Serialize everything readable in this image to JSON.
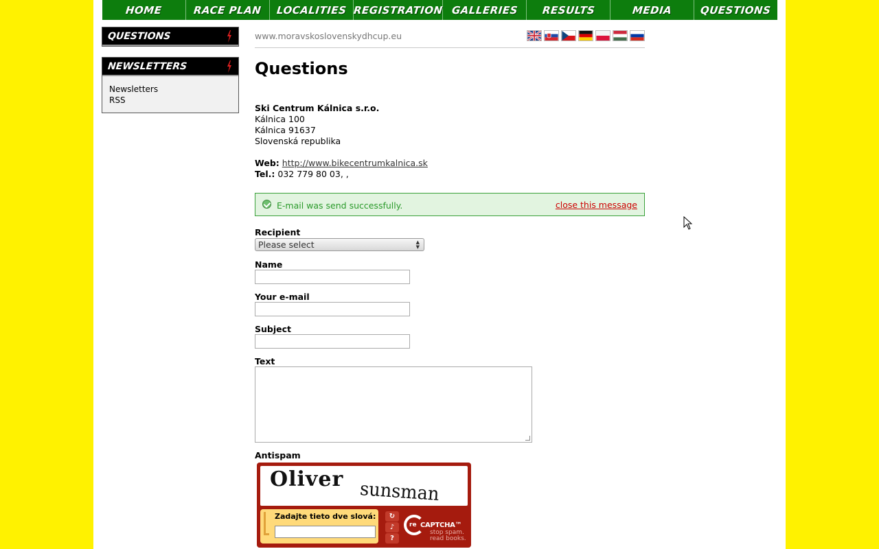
{
  "nav": {
    "items": [
      "HOME",
      "RACE PLAN",
      "LOCALITIES",
      "REGISTRATION",
      "GALLERIES",
      "RESULTS",
      "MEDIA",
      "QUESTIONS"
    ]
  },
  "sidebar": {
    "questions_title": "QUESTIONS",
    "newsletters_title": "NEWSLETTERS",
    "newsletters_links": [
      "Newsletters",
      "RSS"
    ],
    "bolt_icon": "lightning-bolt-icon"
  },
  "header": {
    "url": "www.moravskoslovenskydhcup.eu",
    "flags": [
      "uk-flag-icon",
      "slovakia-flag-icon",
      "czech-flag-icon",
      "germany-flag-icon",
      "poland-flag-icon",
      "hungary-flag-icon",
      "russia-flag-icon"
    ]
  },
  "main": {
    "title": "Questions",
    "company": {
      "name": "Ski Centrum Kálnica s.r.o.",
      "street": "Kálnica 100",
      "city": "Kálnica 91637",
      "country": "Slovenská republika",
      "web_label": "Web:",
      "web_value": "http://www.bikecentrumkalnica.sk",
      "tel_label": "Tel.:",
      "tel_value": "032 779 80 03, ,"
    },
    "message": {
      "text": "E-mail was send successfully.",
      "close": "close this message",
      "color": "#2a9a2a"
    },
    "form": {
      "recipient_label": "Recipient",
      "recipient_value": "Please select",
      "name_label": "Name",
      "email_label": "Your e-mail",
      "subject_label": "Subject",
      "text_label": "Text",
      "antispam_label": "Antispam"
    },
    "captcha": {
      "word1": "Oliver",
      "word2": "sunsman",
      "prompt": "Zadajte tieto dve slová:",
      "brand_re": "re",
      "brand": "CAPTCHA™",
      "tagline1": "stop spam.",
      "tagline2": "read books."
    }
  },
  "colors": {
    "background": "#fff200",
    "nav": "#0d7d0d",
    "captcha": "#a51b0e"
  }
}
